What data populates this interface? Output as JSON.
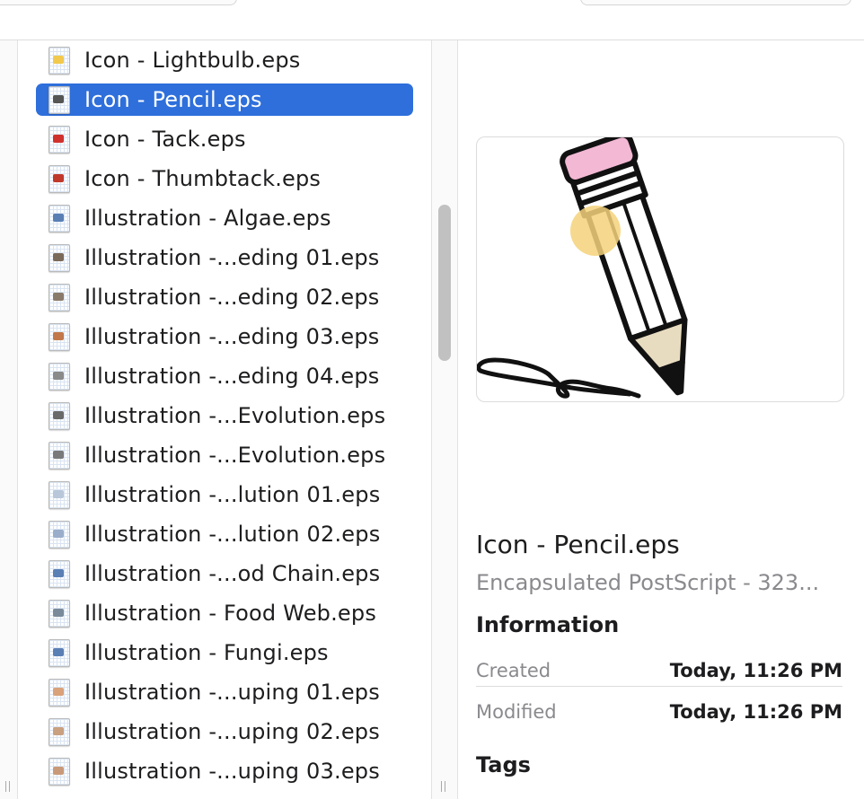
{
  "files": [
    {
      "name": "Icon - Lightbulb.eps",
      "icon": "lightbulb-thumbnail-icon",
      "mark": "#f2c94c",
      "selected": false
    },
    {
      "name": "Icon - Pencil.eps",
      "icon": "pencil-thumbnail-icon",
      "mark": "#555555",
      "selected": true
    },
    {
      "name": "Icon - Tack.eps",
      "icon": "tack-thumbnail-icon",
      "mark": "#d0312d",
      "selected": false
    },
    {
      "name": "Icon - Thumbtack.eps",
      "icon": "thumbtack-thumbnail-icon",
      "mark": "#c0392b",
      "selected": false
    },
    {
      "name": "Illustration - Algae.eps",
      "icon": "eps-file-icon",
      "mark": "#5a7fb5",
      "selected": false
    },
    {
      "name": "Illustration -...eding 01.eps",
      "icon": "eps-file-icon",
      "mark": "#7a6a5a",
      "selected": false
    },
    {
      "name": "Illustration -...eding 02.eps",
      "icon": "eps-file-icon",
      "mark": "#8a7a6a",
      "selected": false
    },
    {
      "name": "Illustration -...eding 03.eps",
      "icon": "eps-file-icon",
      "mark": "#c2784a",
      "selected": false
    },
    {
      "name": "Illustration -...eding 04.eps",
      "icon": "eps-file-icon",
      "mark": "#8a8a8a",
      "selected": false
    },
    {
      "name": "Illustration -...Evolution.eps",
      "icon": "eps-file-icon",
      "mark": "#6a6a6a",
      "selected": false
    },
    {
      "name": "Illustration -...Evolution.eps",
      "icon": "eps-file-icon",
      "mark": "#7a7a7a",
      "selected": false
    },
    {
      "name": "Illustration -...lution 01.eps",
      "icon": "eps-file-icon",
      "mark": "#b9c7da",
      "selected": false
    },
    {
      "name": "Illustration -...lution 02.eps",
      "icon": "eps-file-icon",
      "mark": "#9aaecb",
      "selected": false
    },
    {
      "name": "Illustration -...od Chain.eps",
      "icon": "eps-file-icon",
      "mark": "#5a7fb5",
      "selected": false
    },
    {
      "name": "Illustration - Food Web.eps",
      "icon": "eps-file-icon",
      "mark": "#7a8a9a",
      "selected": false
    },
    {
      "name": "Illustration - Fungi.eps",
      "icon": "eps-file-icon",
      "mark": "#5a7fb5",
      "selected": false
    },
    {
      "name": "Illustration -...uping 01.eps",
      "icon": "eps-file-icon",
      "mark": "#d9a27a",
      "selected": false
    },
    {
      "name": "Illustration -...uping 02.eps",
      "icon": "eps-file-icon",
      "mark": "#c9a080",
      "selected": false
    },
    {
      "name": "Illustration -...uping 03.eps",
      "icon": "eps-file-icon",
      "mark": "#c99a7a",
      "selected": false
    }
  ],
  "preview": {
    "title": "Icon - Pencil.eps",
    "kind": "Encapsulated PostScript - 323...",
    "information_heading": "Information",
    "created_label": "Created",
    "created_value": "Today, 11:26 PM",
    "modified_label": "Modified",
    "modified_value": "Today, 11:26 PM",
    "tags_heading": "Tags"
  },
  "colors": {
    "selection": "#2e6fdb",
    "pencil_eraser": "#f2b8d4",
    "pencil_highlight": "#f5d27a",
    "pencil_wood": "#e8dcc0"
  }
}
